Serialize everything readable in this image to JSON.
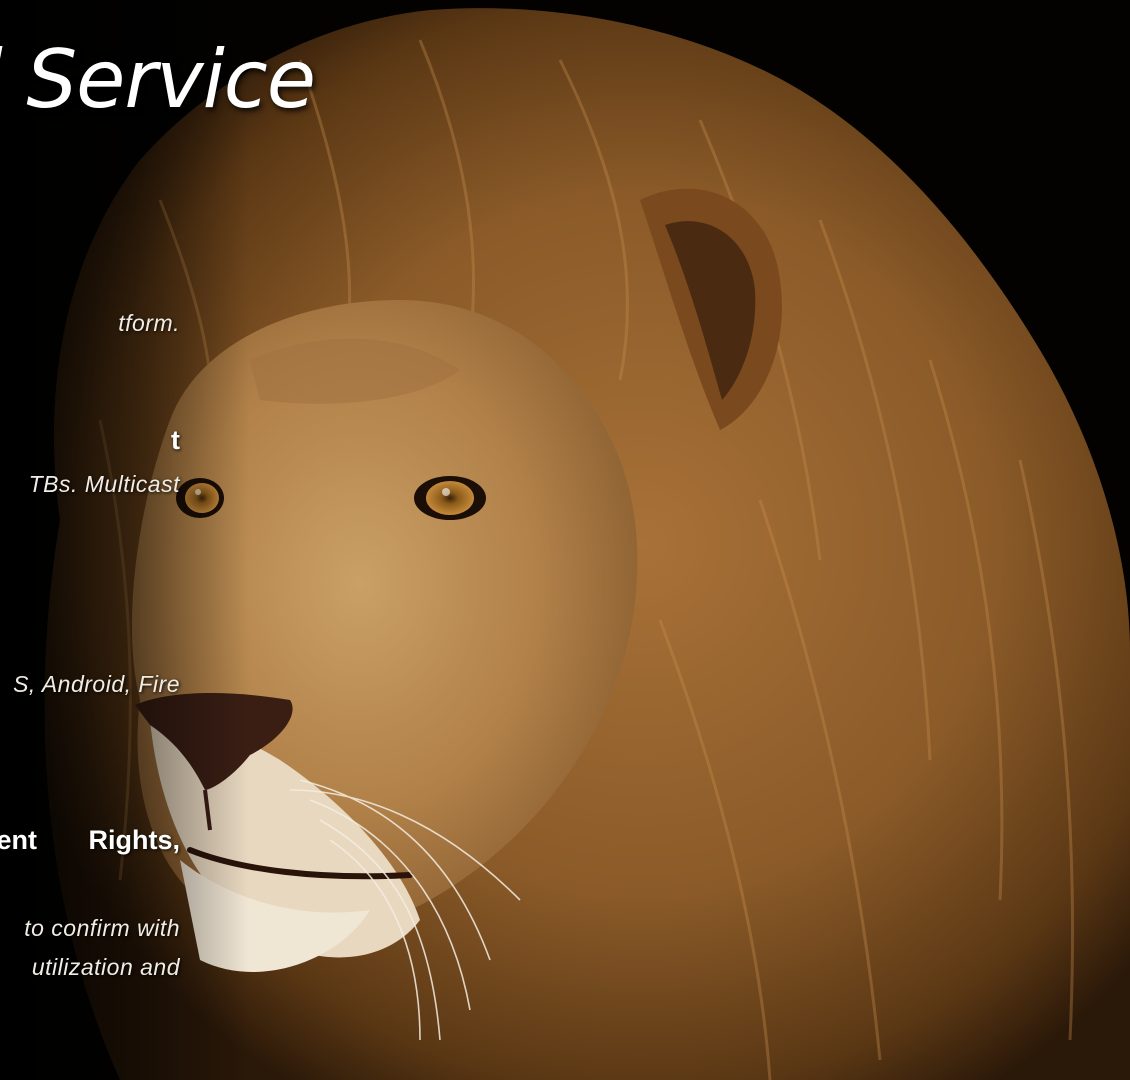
{
  "hero": {
    "title": "l Service"
  },
  "sections": [
    {
      "desc": "tform."
    },
    {
      "heading": "t",
      "desc": "TBs.  Multicast"
    },
    {
      "desc": "S, Android, Fire"
    },
    {
      "heading_left": "ent",
      "heading_right": "Rights,",
      "desc_lines": [
        "to  confirm  with",
        "utilization  and"
      ]
    }
  ],
  "background": {
    "image": "lion-portrait",
    "colors": {
      "backdrop": "#030201",
      "mane": "#8a5a28",
      "face": "#b88850",
      "text": "#f1ece4"
    }
  }
}
